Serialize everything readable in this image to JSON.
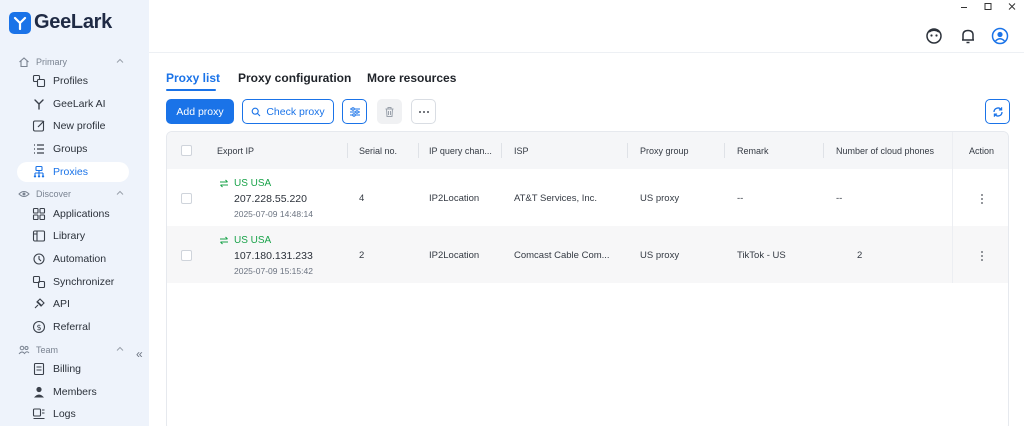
{
  "brand": {
    "name": "GeeLark"
  },
  "sidebar": {
    "sections": [
      {
        "label": "Primary"
      },
      {
        "label": "Discover"
      },
      {
        "label": "Team"
      }
    ],
    "items": [
      {
        "label": "Profiles"
      },
      {
        "label": "GeeLark AI"
      },
      {
        "label": "New profile"
      },
      {
        "label": "Groups"
      },
      {
        "label": "Proxies"
      },
      {
        "label": "Applications"
      },
      {
        "label": "Library"
      },
      {
        "label": "Automation"
      },
      {
        "label": "Synchronizer"
      },
      {
        "label": "API"
      },
      {
        "label": "Referral"
      },
      {
        "label": "Billing"
      },
      {
        "label": "Members"
      },
      {
        "label": "Logs"
      }
    ],
    "active_item": "Proxies",
    "collapse_icon": "double-chevron-left-icon"
  },
  "header": {
    "icons": [
      "support-bot-icon",
      "bell-icon",
      "user-avatar-icon"
    ],
    "window_controls": [
      "minimize-icon",
      "maximize-icon",
      "close-icon"
    ]
  },
  "tabs": [
    {
      "label": "Proxy list"
    },
    {
      "label": "Proxy configuration"
    },
    {
      "label": "More resources"
    }
  ],
  "toolbar": {
    "add_label": "Add proxy",
    "check_label": "Check proxy",
    "icons": [
      "filter-settings-icon",
      "trash-icon",
      "more-icon",
      "refresh-icon"
    ]
  },
  "table": {
    "columns": [
      "Export IP",
      "Serial no.",
      "IP query chan...",
      "ISP",
      "Proxy group",
      "Remark",
      "Number of cloud phones",
      "Action"
    ],
    "rows": [
      {
        "location": "US USA",
        "ip": "207.228.55.220",
        "datetime": "2025-07-09 14:48:14",
        "serial": "4",
        "query_channel": "IP2Location",
        "isp": "AT&T Services, Inc.",
        "group": "US proxy",
        "remark": "--",
        "cloud_phones": "--"
      },
      {
        "location": "US USA",
        "ip": "107.180.131.233",
        "datetime": "2025-07-09 15:15:42",
        "serial": "2",
        "query_channel": "IP2Location",
        "isp": "Comcast Cable Com...",
        "group": "US proxy",
        "remark": "TikTok - US",
        "cloud_phones": "2"
      }
    ]
  },
  "colors": {
    "accent": "#1a73e8",
    "success": "#1aa34a",
    "sidebar_bg": "#eef3fb"
  }
}
